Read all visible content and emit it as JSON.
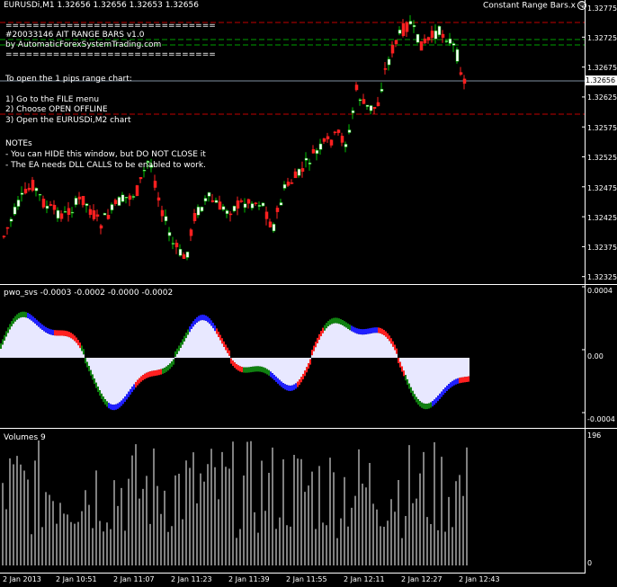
{
  "header": {
    "symbol_info": "EURUSDi,M1  1.32656  1.32656  1.32653  1.32656",
    "ea_name": "Constant Range Bars.x"
  },
  "notes": {
    "line1": "#20033146 AIT RANGE BARS v1.0",
    "line2": "by AutomaticForexSystemTrading.com",
    "line3": "To open the 1 pips range chart:",
    "line4": "1) Go to the FILE menu",
    "line5": "2) Choose OPEN OFFLINE",
    "line6": "3) Open the EURUSDi,M2 chart",
    "line7": "NOTEs",
    "line8": " - You can HIDE this window, but DO NOT CLOSE it",
    "line9": " - The EA needs DLL CALLS to be enabled to work."
  },
  "price_axis": {
    "labels": [
      "1.32775",
      "1.32725",
      "1.32675",
      "1.32656",
      "1.32625",
      "1.32575",
      "1.32525",
      "1.32475",
      "1.32425",
      "1.32375",
      "1.32325"
    ],
    "current": "1.32656"
  },
  "indicator": {
    "title": "pwo_svs -0.0003 -0.0002 -0.0000 -0.0002",
    "axis": [
      "0.0004",
      "0.00",
      "-0.0004"
    ]
  },
  "volume": {
    "title": "Volumes 9",
    "axis": [
      "196",
      "0"
    ]
  },
  "time_axis": [
    "2 Jan 2013",
    "2 Jan 10:51",
    "2 Jan 11:07",
    "2 Jan 11:23",
    "2 Jan 11:39",
    "2 Jan 11:55",
    "2 Jan 12:11",
    "2 Jan 12:27",
    "2 Jan 12:43"
  ],
  "colors": {
    "bg": "#000000",
    "fg": "#ffffff",
    "bull": "#00c000",
    "bear": "#ff2020",
    "level_red": "#c00000",
    "level_green": "#00a000",
    "current_line": "#8090a0",
    "hist_main": "#e8e8ff",
    "hist_red": "#ff2020",
    "hist_blue": "#2020ff",
    "hist_green": "#108010"
  }
}
